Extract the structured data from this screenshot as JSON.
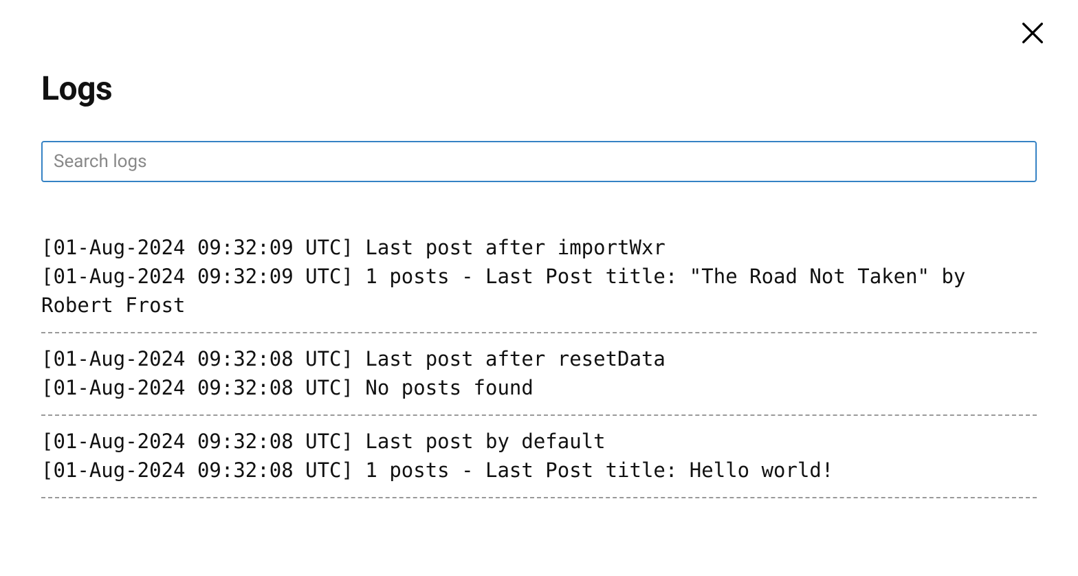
{
  "page": {
    "title": "Logs"
  },
  "search": {
    "placeholder": "Search logs",
    "value": ""
  },
  "logs": [
    {
      "lines": [
        "[01-Aug-2024 09:32:09 UTC] Last post after importWxr",
        "[01-Aug-2024 09:32:09 UTC] 1 posts - Last Post title: \"The Road Not Taken\" by Robert Frost"
      ]
    },
    {
      "lines": [
        "[01-Aug-2024 09:32:08 UTC] Last post after resetData",
        "[01-Aug-2024 09:32:08 UTC] No posts found"
      ]
    },
    {
      "lines": [
        "[01-Aug-2024 09:32:08 UTC] Last post by default",
        "[01-Aug-2024 09:32:08 UTC] 1 posts - Last Post title: Hello world!"
      ]
    }
  ]
}
